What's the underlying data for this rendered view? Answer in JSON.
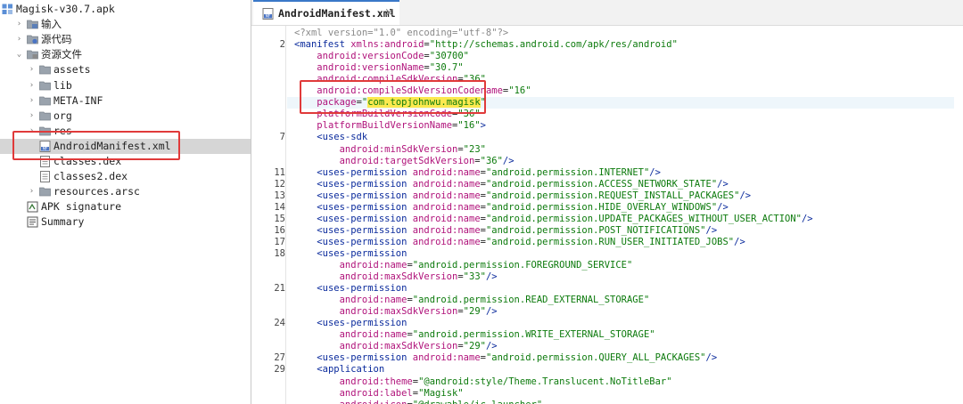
{
  "tree": {
    "root_label": "Magisk-v30.7.apk",
    "items": [
      {
        "label": "输入",
        "icon": "input-icon",
        "expanded": false,
        "cjk": true
      },
      {
        "label": "源代码",
        "icon": "source-code-icon",
        "expanded": false,
        "cjk": true
      },
      {
        "label": "资源文件",
        "icon": "resources-icon",
        "expanded": true,
        "cjk": true
      },
      {
        "label": "assets",
        "icon": "folder-icon"
      },
      {
        "label": "lib",
        "icon": "folder-icon"
      },
      {
        "label": "META-INF",
        "icon": "folder-icon"
      },
      {
        "label": "org",
        "icon": "folder-icon"
      },
      {
        "label": "res",
        "icon": "folder-icon"
      },
      {
        "label": "AndroidManifest.xml",
        "icon": "manifest-file-icon",
        "selected": true
      },
      {
        "label": "classes.dex",
        "icon": "dex-file-icon"
      },
      {
        "label": "classes2.dex",
        "icon": "dex-file-icon"
      },
      {
        "label": "resources.arsc",
        "icon": "arsc-file-icon"
      },
      {
        "label": "APK signature",
        "icon": "signature-icon"
      },
      {
        "label": "Summary",
        "icon": "summary-icon"
      }
    ]
  },
  "editor": {
    "tab_title": "AndroidManifest.xml",
    "tab_close": "×",
    "lines": [
      {
        "n": "",
        "html": "<span class='pi'>&lt;?xml version=\"1.0\" encoding=\"utf-8\"?&gt;</span>"
      },
      {
        "n": "2",
        "text": "<manifest xmlns:android=\"http://schemas.android.com/apk/res/android\""
      },
      {
        "n": "",
        "text": "    android:versionCode=\"30700\""
      },
      {
        "n": "",
        "text": "    android:versionName=\"30.7\""
      },
      {
        "n": "",
        "text": "    android:compileSdkVersion=\"36\""
      },
      {
        "n": "",
        "text": "    android:compileSdkVersionCodename=\"16\""
      },
      {
        "n": "",
        "text": "    package=\"com.topjohnwu.magisk\"",
        "highlight": true
      },
      {
        "n": "",
        "text": "    platformBuildVersionCode=\"36\""
      },
      {
        "n": "",
        "text": "    platformBuildVersionName=\"16\">"
      },
      {
        "n": "7",
        "text": "    <uses-sdk"
      },
      {
        "n": "",
        "text": "        android:minSdkVersion=\"23\""
      },
      {
        "n": "",
        "text": "        android:targetSdkVersion=\"36\"/>"
      },
      {
        "n": "11",
        "text": "    <uses-permission android:name=\"android.permission.INTERNET\"/>"
      },
      {
        "n": "12",
        "text": "    <uses-permission android:name=\"android.permission.ACCESS_NETWORK_STATE\"/>"
      },
      {
        "n": "13",
        "text": "    <uses-permission android:name=\"android.permission.REQUEST_INSTALL_PACKAGES\"/>"
      },
      {
        "n": "14",
        "text": "    <uses-permission android:name=\"android.permission.HIDE_OVERLAY_WINDOWS\"/>"
      },
      {
        "n": "15",
        "text": "    <uses-permission android:name=\"android.permission.UPDATE_PACKAGES_WITHOUT_USER_ACTION\"/>"
      },
      {
        "n": "16",
        "text": "    <uses-permission android:name=\"android.permission.POST_NOTIFICATIONS\"/>"
      },
      {
        "n": "17",
        "text": "    <uses-permission android:name=\"android.permission.RUN_USER_INITIATED_JOBS\"/>"
      },
      {
        "n": "18",
        "text": "    <uses-permission"
      },
      {
        "n": "",
        "text": "        android:name=\"android.permission.FOREGROUND_SERVICE\""
      },
      {
        "n": "",
        "text": "        android:maxSdkVersion=\"33\"/>"
      },
      {
        "n": "21",
        "text": "    <uses-permission"
      },
      {
        "n": "",
        "text": "        android:name=\"android.permission.READ_EXTERNAL_STORAGE\""
      },
      {
        "n": "",
        "text": "        android:maxSdkVersion=\"29\"/>"
      },
      {
        "n": "24",
        "text": "    <uses-permission"
      },
      {
        "n": "",
        "text": "        android:name=\"android.permission.WRITE_EXTERNAL_STORAGE\""
      },
      {
        "n": "",
        "text": "        android:maxSdkVersion=\"29\"/>"
      },
      {
        "n": "27",
        "text": "    <uses-permission android:name=\"android.permission.QUERY_ALL_PACKAGES\"/>"
      },
      {
        "n": "29",
        "text": "    <application"
      },
      {
        "n": "",
        "text": "        android:theme=\"@android:style/Theme.Translucent.NoTitleBar\""
      },
      {
        "n": "",
        "text": "        android:label=\"Magisk\""
      },
      {
        "n": "",
        "text": "        android:icon=\"@drawable/ic_launcher\""
      }
    ],
    "highlighted_value": "com.topjohnwu.magisk"
  },
  "colors": {
    "tag": "#0a2a9c",
    "attribute": "#b0127a",
    "string": "#0c7a0c",
    "annotation_box": "#e03a3a",
    "selection": "#d6d6d6",
    "search_highlight": "#fce94f"
  }
}
